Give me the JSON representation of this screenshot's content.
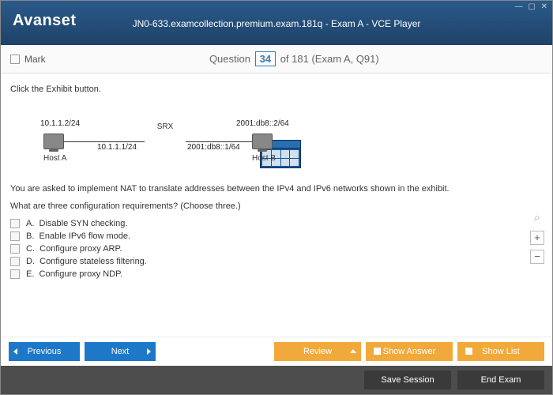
{
  "window": {
    "logo": "Avanset",
    "title": "JN0-633.examcollection.premium.exam.181q - Exam A - VCE Player",
    "controls": "— ▢ ✕"
  },
  "header": {
    "mark": "Mark",
    "q_label": "Question",
    "q_num": "34",
    "q_suffix": "of 181 (Exam A, Q91)"
  },
  "question": {
    "instruction": "Click the Exhibit button.",
    "diagram": {
      "hostA_ip": "10.1.1.2/24",
      "hostA_label": "Host A",
      "srx_left": "10.1.1.1/24",
      "srx_label": "SRX",
      "srx_right": "2001:db8::1/64",
      "hostB_ip": "2001:db8::2/64",
      "hostB_label": "Host B"
    },
    "text": "You are asked to implement NAT to translate addresses between the IPv4 and IPv6 networks shown in the exhibit.",
    "subq": "What are three configuration requirements? (Choose three.)",
    "options": [
      {
        "letter": "A.",
        "text": "Disable SYN checking."
      },
      {
        "letter": "B.",
        "text": "Enable IPv6 flow mode."
      },
      {
        "letter": "C.",
        "text": "Configure proxy ARP."
      },
      {
        "letter": "D.",
        "text": "Configure stateless filtering."
      },
      {
        "letter": "E.",
        "text": "Configure proxy NDP."
      }
    ]
  },
  "buttons": {
    "previous": "Previous",
    "next": "Next",
    "review": "Review",
    "show_answer": "Show Answer",
    "show_list": "Show List",
    "save_session": "Save Session",
    "end_exam": "End Exam"
  },
  "zoom": {
    "mag": "⌕",
    "plus": "+",
    "minus": "−"
  }
}
